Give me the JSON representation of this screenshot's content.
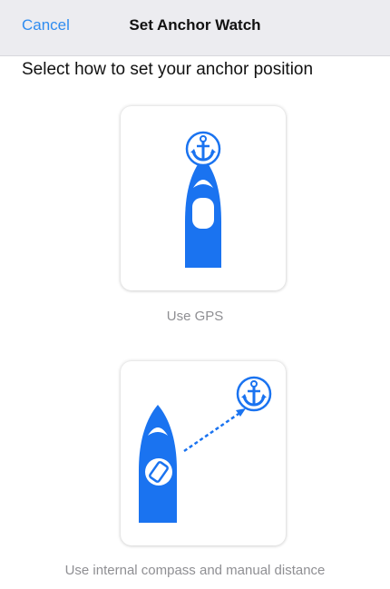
{
  "navbar": {
    "cancel_label": "Cancel",
    "title": "Set Anchor Watch"
  },
  "instruction": "Select how to set your anchor position",
  "options": [
    {
      "label": "Use GPS",
      "icon": "boat-with-anchor-icon"
    },
    {
      "label": "Use internal compass and manual distance",
      "icon": "boat-phone-compass-icon"
    }
  ],
  "colors": {
    "accent": "#2f8cf0",
    "icon_blue": "#1a73f0",
    "navbar_bg": "#ececf0",
    "label_gray": "#8f8f93"
  }
}
